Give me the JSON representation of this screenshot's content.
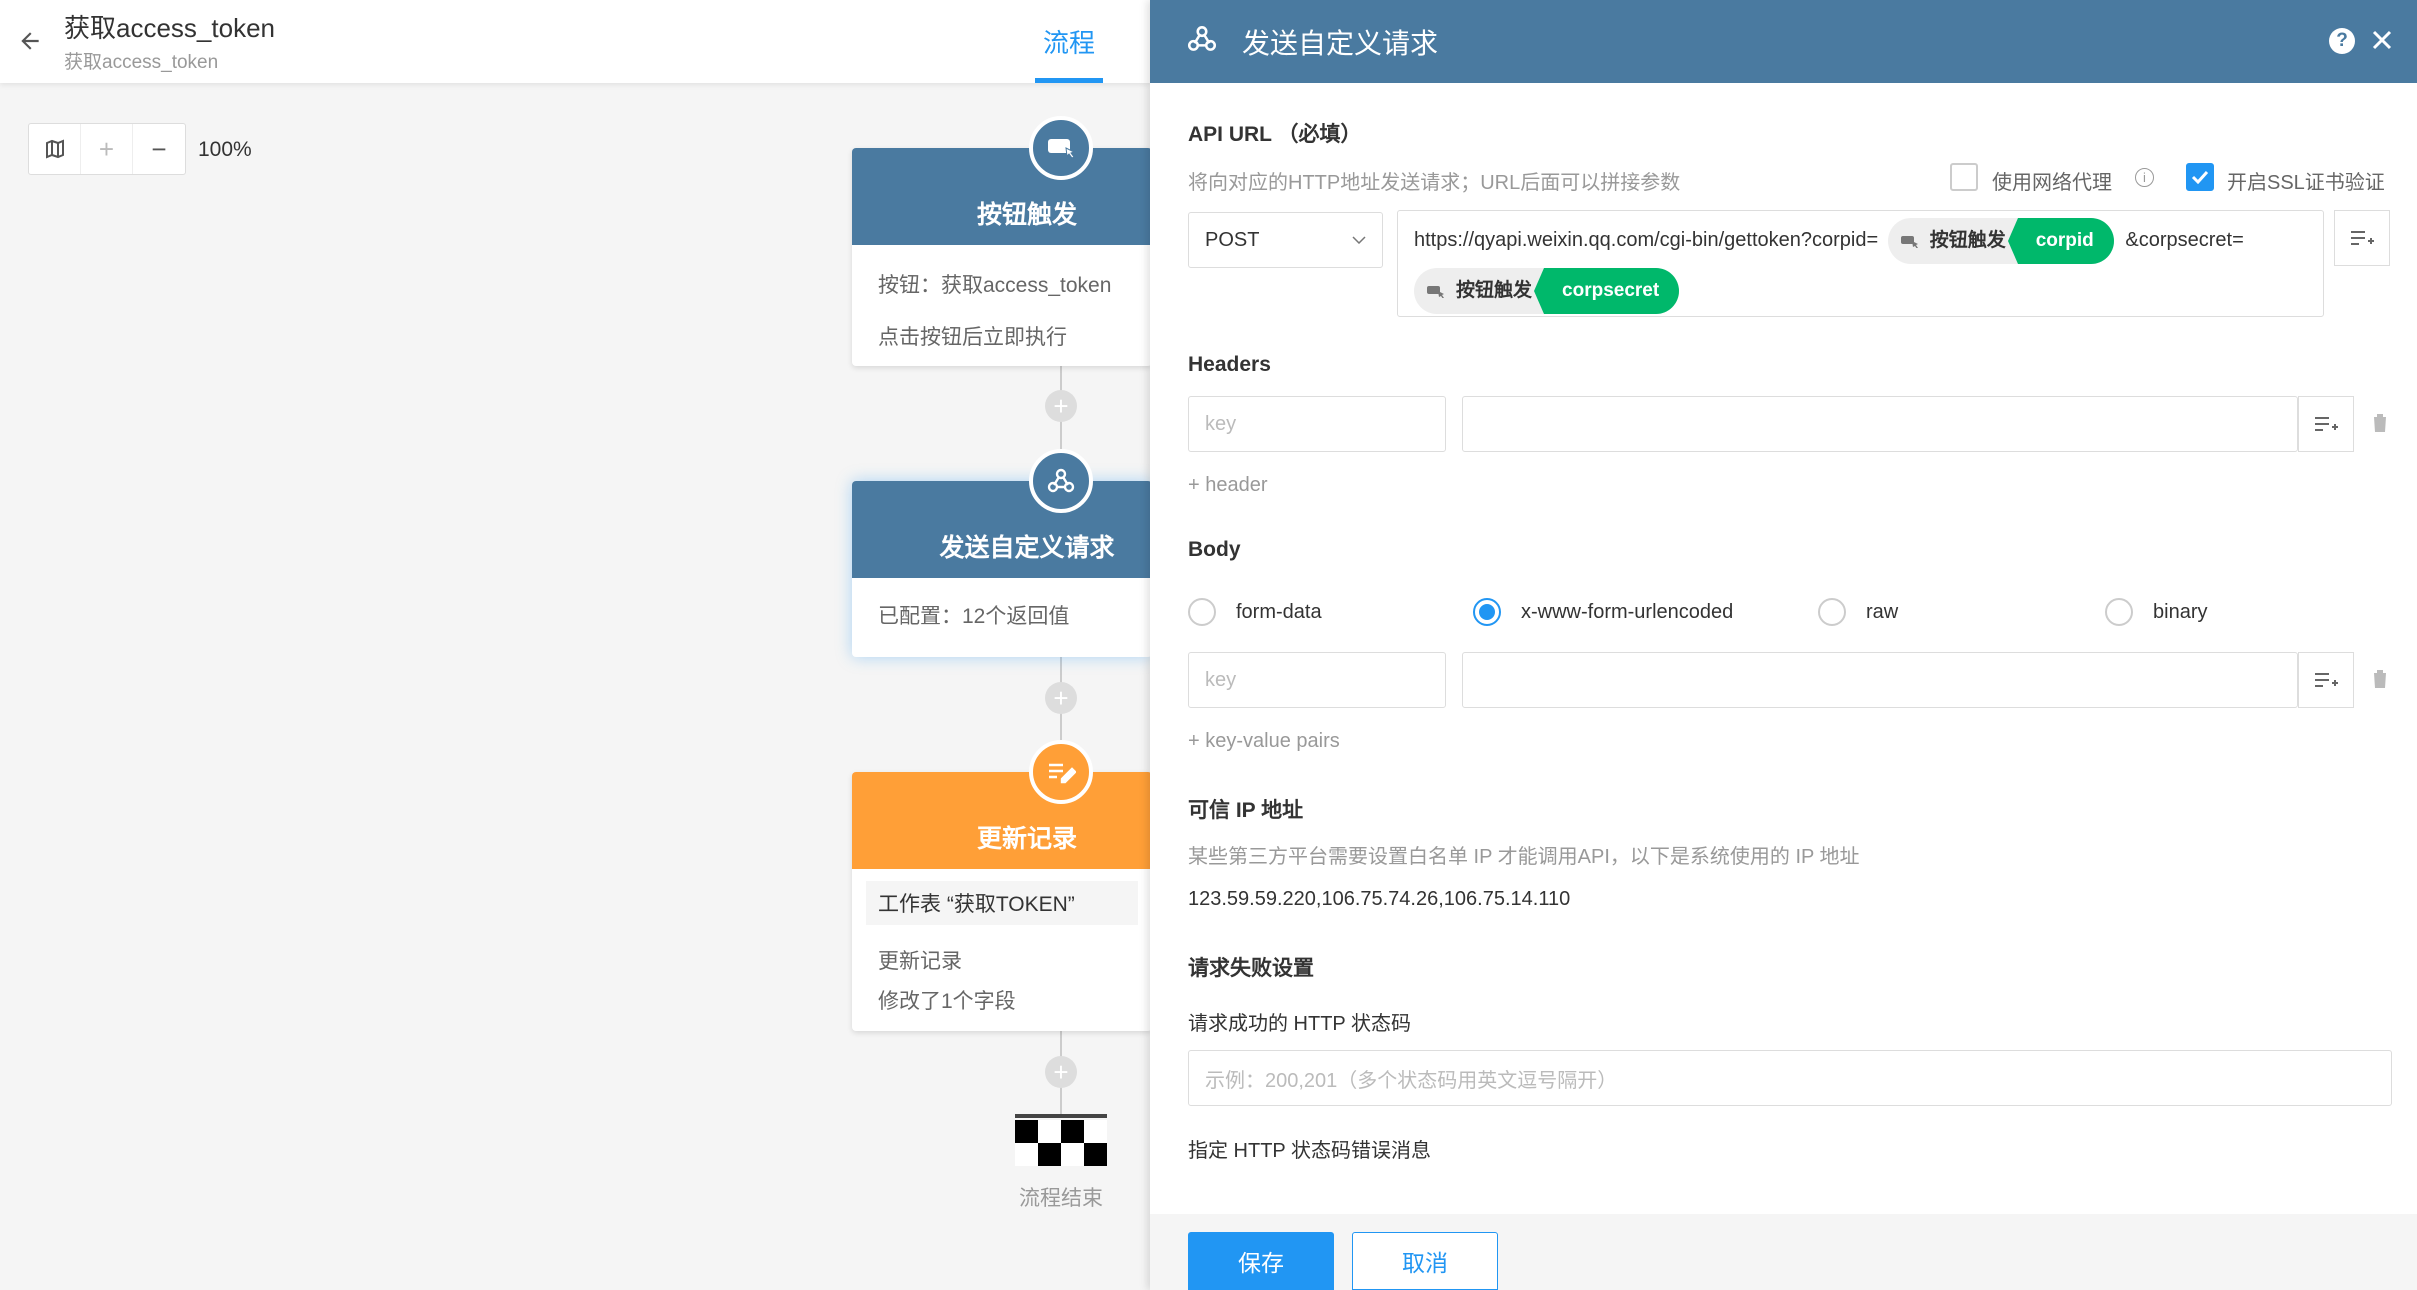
{
  "header": {
    "title": "获取access_token",
    "subtitle": "获取access_token",
    "tab_flow": "流程"
  },
  "zoom": {
    "level": "100%"
  },
  "canvas": {
    "node_button": {
      "title": "按钮触发",
      "line1": "按钮：获取access_token",
      "line2": "点击按钮后立即执行",
      "color": "#4a7aa0"
    },
    "node_request": {
      "title": "发送自定义请求",
      "line1": "已配置：12个返回值",
      "color": "#4a7aa0"
    },
    "node_update": {
      "title": "更新记录",
      "sheet": "工作表 “获取TOKEN”",
      "line1": "更新记录",
      "line2": "修改了1个字段",
      "color": "#ff9f37"
    },
    "end_label": "流程结束"
  },
  "panel": {
    "title": "发送自定义请求",
    "help_icon": "?",
    "api": {
      "title": "API URL （必填）",
      "desc": "将向对应的HTTP地址发送请求；URL后面可以拼接参数",
      "proxy_label": "使用网络代理",
      "ssl_label": "开启SSL证书验证",
      "proxy_checked": false,
      "ssl_checked": true,
      "method": "POST",
      "url_part1": "https://qyapi.weixin.qq.com/cgi-bin/gettoken?corpid=",
      "tag1_source": "按钮触发",
      "tag1_field": "corpid",
      "url_part2": "&corpsecret=",
      "tag2_source": "按钮触发",
      "tag2_field": "corpsecret"
    },
    "headers": {
      "title": "Headers",
      "key_placeholder": "key",
      "add_label": "+ header"
    },
    "body": {
      "title": "Body",
      "options": [
        "form-data",
        "x-www-form-urlencoded",
        "raw",
        "binary"
      ],
      "selected": "x-www-form-urlencoded",
      "key_placeholder": "key",
      "add_label": "+ key-value pairs"
    },
    "ip": {
      "title": "可信 IP 地址",
      "desc": "某些第三方平台需要设置白名单 IP 才能调用API，以下是系统使用的 IP 地址",
      "value": "123.59.59.220,106.75.74.26,106.75.14.110"
    },
    "fail": {
      "title": "请求失败设置",
      "status_label": "请求成功的 HTTP 状态码",
      "status_placeholder": "示例：200,201（多个状态码用英文逗号隔开）",
      "error_label": "指定 HTTP 状态码错误消息"
    },
    "footer": {
      "save": "保存",
      "cancel": "取消"
    }
  }
}
